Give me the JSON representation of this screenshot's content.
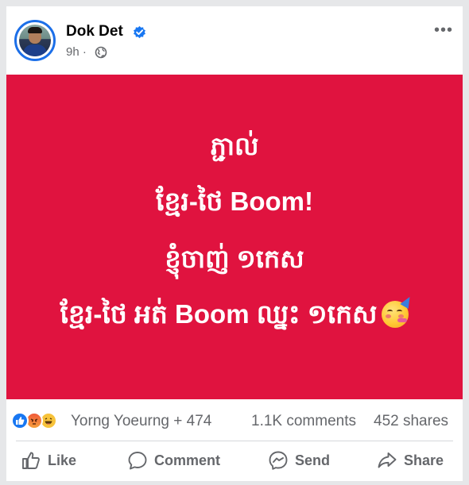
{
  "post": {
    "author_name": "Dok Det",
    "time": "9h",
    "separator": "·",
    "more_label": "•••",
    "lines": [
      "ភ្ជាល់",
      "ខ្មែរ-ថៃ Boom!",
      "ខ្ញុំចាញ់ ១កេស",
      "ខ្មែរ-ថៃ អត់ Boom ឈ្នះ ១កេស"
    ],
    "background_color": "#e0133f"
  },
  "stats": {
    "reactions": [
      "like-icon",
      "angry-icon",
      "haha-icon"
    ],
    "reaction_names": "Yorng Yoeurng + 474",
    "comments": "1.1K comments",
    "shares": "452 shares"
  },
  "actions": {
    "like": "Like",
    "comment": "Comment",
    "send": "Send",
    "share": "Share"
  }
}
